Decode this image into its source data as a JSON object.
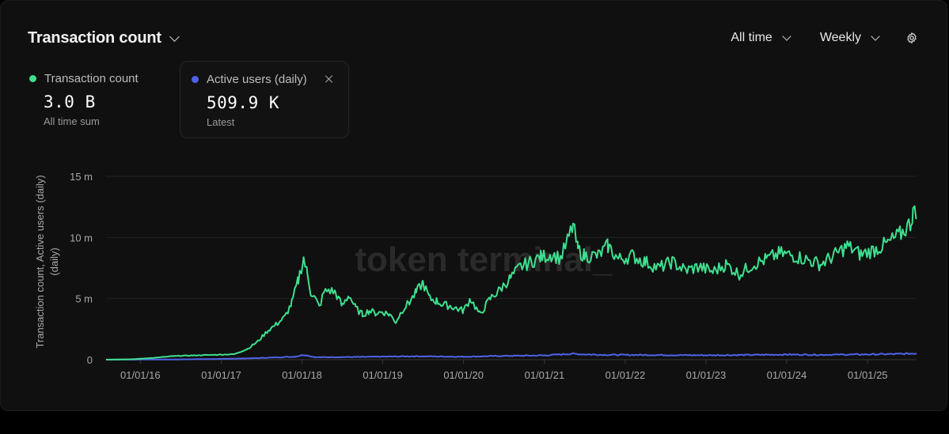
{
  "header": {
    "title": "Transaction count"
  },
  "controls": {
    "range": "All time",
    "interval": "Weekly"
  },
  "metrics": [
    {
      "label": "Transaction count",
      "value": "3.0 B",
      "sub": "All time sum",
      "color": "#3ee08f"
    },
    {
      "label": "Active users (daily)",
      "value": "509.9 K",
      "sub": "Latest",
      "color": "#4f63e8"
    }
  ],
  "watermark": "token terminal_",
  "chart_data": {
    "type": "line",
    "ylabel": "Transaction count, Active users (daily)",
    "ylim": [
      0,
      15000000
    ],
    "y_ticks": [
      {
        "value": 0,
        "label": "0"
      },
      {
        "value": 5000000,
        "label": "5 m"
      },
      {
        "value": 10000000,
        "label": "10 m"
      },
      {
        "value": 15000000,
        "label": "15 m"
      }
    ],
    "x_range": [
      "2015-07-30",
      "2025-08-10"
    ],
    "x_ticks": [
      "01/01/16",
      "01/01/17",
      "01/01/18",
      "01/01/19",
      "01/01/20",
      "01/01/21",
      "01/01/22",
      "01/01/23",
      "01/01/24",
      "01/01/25"
    ],
    "series": [
      {
        "name": "Transaction count",
        "color": "#3ee08f",
        "points": [
          [
            "2015-07-30",
            0
          ],
          [
            "2015-12-01",
            40000
          ],
          [
            "2016-03-01",
            150000
          ],
          [
            "2016-06-01",
            300000
          ],
          [
            "2016-09-01",
            350000
          ],
          [
            "2016-12-01",
            400000
          ],
          [
            "2017-03-01",
            450000
          ],
          [
            "2017-05-01",
            900000
          ],
          [
            "2017-06-15",
            1500000
          ],
          [
            "2017-08-01",
            2400000
          ],
          [
            "2017-09-15",
            3000000
          ],
          [
            "2017-10-15",
            3500000
          ],
          [
            "2017-11-15",
            4600000
          ],
          [
            "2017-12-15",
            6500000
          ],
          [
            "2018-01-08",
            8300000
          ],
          [
            "2018-01-25",
            7000000
          ],
          [
            "2018-02-10",
            5500000
          ],
          [
            "2018-03-01",
            5000000
          ],
          [
            "2018-03-20",
            4300000
          ],
          [
            "2018-04-10",
            5500000
          ],
          [
            "2018-05-01",
            5700000
          ],
          [
            "2018-06-01",
            5500000
          ],
          [
            "2018-07-01",
            4400000
          ],
          [
            "2018-08-01",
            5300000
          ],
          [
            "2018-09-01",
            4200000
          ],
          [
            "2018-10-01",
            3700000
          ],
          [
            "2018-11-01",
            4000000
          ],
          [
            "2018-12-01",
            3800000
          ],
          [
            "2019-01-01",
            3900000
          ],
          [
            "2019-02-01",
            3700000
          ],
          [
            "2019-03-01",
            3100000
          ],
          [
            "2019-04-01",
            4100000
          ],
          [
            "2019-05-01",
            4700000
          ],
          [
            "2019-06-01",
            5500000
          ],
          [
            "2019-07-01",
            6300000
          ],
          [
            "2019-08-01",
            5000000
          ],
          [
            "2019-09-01",
            4800000
          ],
          [
            "2019-10-01",
            4500000
          ],
          [
            "2019-11-01",
            4400000
          ],
          [
            "2019-12-01",
            4200000
          ],
          [
            "2020-01-01",
            4000000
          ],
          [
            "2020-02-01",
            5000000
          ],
          [
            "2020-03-15",
            3700000
          ],
          [
            "2020-05-01",
            5000000
          ],
          [
            "2020-06-01",
            5500000
          ],
          [
            "2020-08-01",
            6700000
          ],
          [
            "2020-09-15",
            7600000
          ],
          [
            "2020-11-01",
            8000000
          ],
          [
            "2020-12-15",
            8400000
          ],
          [
            "2021-02-01",
            8600000
          ],
          [
            "2021-03-15",
            8300000
          ],
          [
            "2021-04-15",
            9700000
          ],
          [
            "2021-05-10",
            11000000
          ],
          [
            "2021-06-01",
            9000000
          ],
          [
            "2021-07-01",
            8500000
          ],
          [
            "2021-09-01",
            8500000
          ],
          [
            "2021-10-15",
            9300000
          ],
          [
            "2021-12-01",
            8200000
          ],
          [
            "2022-02-01",
            8500000
          ],
          [
            "2022-04-01",
            8000000
          ],
          [
            "2022-06-01",
            7500000
          ],
          [
            "2022-08-01",
            8000000
          ],
          [
            "2022-10-01",
            7300000
          ],
          [
            "2022-12-01",
            7600000
          ],
          [
            "2023-02-01",
            7200000
          ],
          [
            "2023-04-01",
            7800000
          ],
          [
            "2023-06-01",
            7000000
          ],
          [
            "2023-08-01",
            7800000
          ],
          [
            "2023-10-01",
            8200000
          ],
          [
            "2023-12-01",
            8700000
          ],
          [
            "2024-02-01",
            8500000
          ],
          [
            "2024-04-01",
            8200000
          ],
          [
            "2024-06-01",
            7800000
          ],
          [
            "2024-08-01",
            8500000
          ],
          [
            "2024-10-01",
            9300000
          ],
          [
            "2024-12-01",
            8600000
          ],
          [
            "2025-02-01",
            9000000
          ],
          [
            "2025-04-01",
            9500000
          ],
          [
            "2025-06-01",
            10300000
          ],
          [
            "2025-07-15",
            11200000
          ],
          [
            "2025-07-25",
            12200000
          ],
          [
            "2025-08-10",
            11600000
          ]
        ]
      },
      {
        "name": "Active users (daily)",
        "color": "#4f63e8",
        "points": [
          [
            "2015-07-30",
            0
          ],
          [
            "2016-06-01",
            20000
          ],
          [
            "2017-01-01",
            60000
          ],
          [
            "2017-06-01",
            120000
          ],
          [
            "2017-12-01",
            250000
          ],
          [
            "2018-01-10",
            400000
          ],
          [
            "2018-03-01",
            200000
          ],
          [
            "2018-09-01",
            220000
          ],
          [
            "2019-06-01",
            280000
          ],
          [
            "2020-01-01",
            240000
          ],
          [
            "2020-06-01",
            300000
          ],
          [
            "2021-01-01",
            350000
          ],
          [
            "2021-05-01",
            480000
          ],
          [
            "2021-09-01",
            400000
          ],
          [
            "2022-06-01",
            380000
          ],
          [
            "2023-01-01",
            360000
          ],
          [
            "2023-06-01",
            380000
          ],
          [
            "2024-01-01",
            420000
          ],
          [
            "2024-06-01",
            400000
          ],
          [
            "2025-01-01",
            430000
          ],
          [
            "2025-06-01",
            470000
          ],
          [
            "2025-08-10",
            509900
          ]
        ]
      }
    ]
  }
}
